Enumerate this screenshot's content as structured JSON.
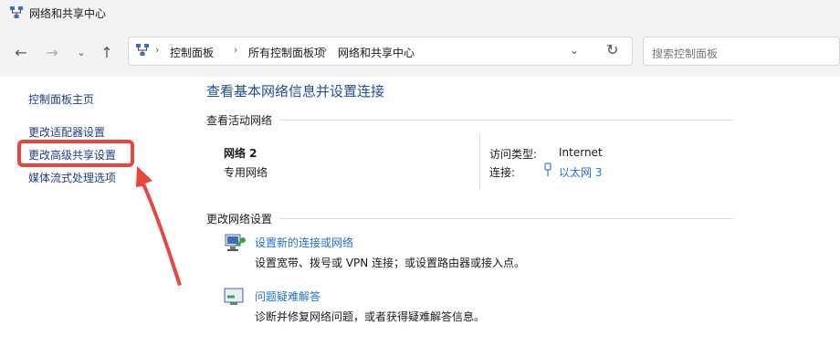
{
  "window": {
    "title": "网络和共享中心"
  },
  "address_bar": {
    "breadcrumbs": [
      "控制面板",
      "所有控制面板项",
      "网络和共享中心"
    ]
  },
  "search": {
    "placeholder": "搜索控制面板"
  },
  "sidebar": {
    "items": [
      {
        "label": "控制面板主页"
      },
      {
        "label": "更改适配器设置"
      },
      {
        "label": "更改高级共享设置"
      },
      {
        "label": "媒体流式处理选项"
      }
    ]
  },
  "main": {
    "title": "查看基本网络信息并设置连接",
    "active_networks_heading": "查看活动网络",
    "network": {
      "name": "网络 2",
      "type": "专用网络",
      "access_type_label": "访问类型:",
      "access_type_value": "Internet",
      "connection_label": "连接:",
      "connection_value": "以太网 3"
    },
    "change_settings_heading": "更改网络设置",
    "tasks": [
      {
        "title": "设置新的连接或网络",
        "description": "设置宽带、拨号或 VPN 连接；或设置路由器或接入点。"
      },
      {
        "title": "问题疑难解答",
        "description": "诊断并修复网络问题，或者获得疑难解答信息。"
      }
    ]
  },
  "annotation": {
    "color": "#e8453c"
  }
}
